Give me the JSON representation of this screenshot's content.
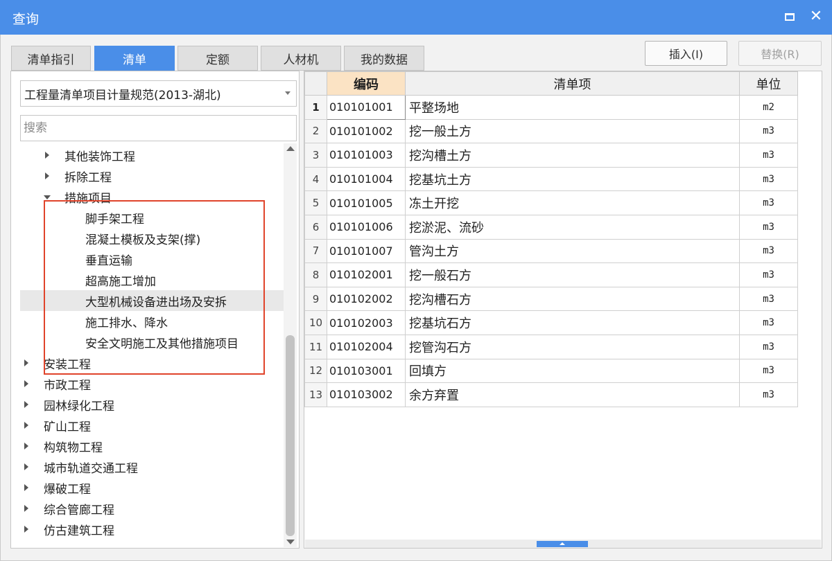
{
  "window": {
    "title": "查询"
  },
  "tabs": [
    {
      "label": "清单指引"
    },
    {
      "label": "清单"
    },
    {
      "label": "定额"
    },
    {
      "label": "人材机"
    },
    {
      "label": "我的数据"
    }
  ],
  "toolbar": {
    "insert_label": "插入(I)",
    "replace_label": "替换(R)"
  },
  "left": {
    "dropdown_value": "工程量清单项目计量规范(2013-湖北)",
    "search_placeholder": "搜索",
    "tree": [
      {
        "label": "其他装饰工程",
        "expander": "collapsed"
      },
      {
        "label": "拆除工程",
        "expander": "collapsed"
      },
      {
        "label": "措施项目",
        "expander": "expanded"
      },
      {
        "label": "脚手架工程",
        "expander": "none"
      },
      {
        "label": "混凝土模板及支架(撑)",
        "expander": "none"
      },
      {
        "label": "垂直运输",
        "expander": "none"
      },
      {
        "label": "超高施工增加",
        "expander": "none"
      },
      {
        "label": "大型机械设备进出场及安拆",
        "expander": "none",
        "selected": true
      },
      {
        "label": "施工排水、降水",
        "expander": "none"
      },
      {
        "label": "安全文明施工及其他措施项目",
        "expander": "none"
      },
      {
        "label": "安装工程",
        "expander": "collapsed"
      },
      {
        "label": "市政工程",
        "expander": "collapsed"
      },
      {
        "label": "园林绿化工程",
        "expander": "collapsed"
      },
      {
        "label": "矿山工程",
        "expander": "collapsed"
      },
      {
        "label": "构筑物工程",
        "expander": "collapsed"
      },
      {
        "label": "城市轨道交通工程",
        "expander": "collapsed"
      },
      {
        "label": "爆破工程",
        "expander": "collapsed"
      },
      {
        "label": "综合管廊工程",
        "expander": "collapsed"
      },
      {
        "label": "仿古建筑工程",
        "expander": "collapsed"
      }
    ]
  },
  "table": {
    "headers": {
      "code": "编码",
      "item": "清单项",
      "unit": "单位"
    },
    "rows": [
      {
        "n": "1",
        "code": "010101001",
        "name": "平整场地",
        "unit": "m2"
      },
      {
        "n": "2",
        "code": "010101002",
        "name": "挖一般土方",
        "unit": "m3"
      },
      {
        "n": "3",
        "code": "010101003",
        "name": "挖沟槽土方",
        "unit": "m3"
      },
      {
        "n": "4",
        "code": "010101004",
        "name": "挖基坑土方",
        "unit": "m3"
      },
      {
        "n": "5",
        "code": "010101005",
        "name": "冻土开挖",
        "unit": "m3"
      },
      {
        "n": "6",
        "code": "010101006",
        "name": "挖淤泥、流砂",
        "unit": "m3"
      },
      {
        "n": "7",
        "code": "010101007",
        "name": "管沟土方",
        "unit": "m3"
      },
      {
        "n": "8",
        "code": "010102001",
        "name": "挖一般石方",
        "unit": "m3"
      },
      {
        "n": "9",
        "code": "010102002",
        "name": "挖沟槽石方",
        "unit": "m3"
      },
      {
        "n": "10",
        "code": "010102003",
        "name": "挖基坑石方",
        "unit": "m3"
      },
      {
        "n": "11",
        "code": "010102004",
        "name": "挖管沟石方",
        "unit": "m3"
      },
      {
        "n": "12",
        "code": "010103001",
        "name": "回填方",
        "unit": "m3"
      },
      {
        "n": "13",
        "code": "010103002",
        "name": "余方弃置",
        "unit": "m3"
      }
    ]
  },
  "colors": {
    "accent": "#4a8ee8",
    "highlight_border": "#e0432a",
    "code_header_bg": "#fbe3c4"
  }
}
